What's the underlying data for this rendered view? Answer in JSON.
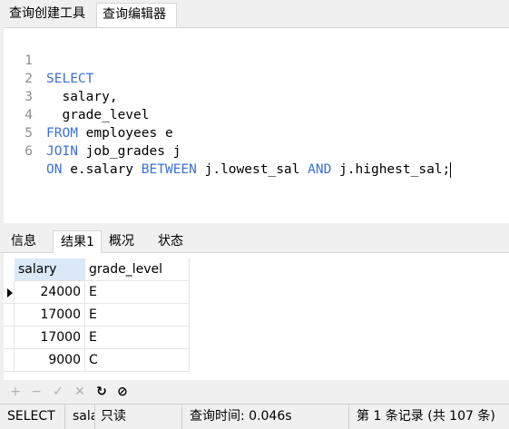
{
  "top_tabs": [
    "查询创建工具",
    "查询编辑器"
  ],
  "editor": {
    "lines": [
      {
        "num": "1",
        "kw1": "SELECT",
        "rest": "",
        "kw2": "",
        "rest2": ""
      },
      {
        "num": "2",
        "kw1": "",
        "rest": "  salary,",
        "kw2": "",
        "rest2": ""
      },
      {
        "num": "3",
        "kw1": "",
        "rest": "  grade_level",
        "kw2": "",
        "rest2": ""
      },
      {
        "num": "4",
        "kw1": "FROM",
        "rest": " employees e",
        "kw2": "",
        "rest2": ""
      },
      {
        "num": "5",
        "kw1": "JOIN",
        "rest": " job_grades j",
        "kw2": "",
        "rest2": ""
      },
      {
        "num": "6",
        "kw1": "ON",
        "rest": " e.salary ",
        "kw2": "BETWEEN",
        "rest2": " j.lowest_sal ",
        "kw3": "AND",
        "rest3": " j.highest_sal;"
      }
    ]
  },
  "bottom_tabs": [
    "信息",
    "结果1",
    "概况",
    "状态"
  ],
  "results": {
    "columns": [
      "salary",
      "grade_level"
    ],
    "rows": [
      [
        "24000",
        "E"
      ],
      [
        "17000",
        "E"
      ],
      [
        "17000",
        "E"
      ],
      [
        "9000",
        "C"
      ]
    ]
  },
  "toolbar": {
    "add": "+",
    "remove": "−",
    "apply": "✓",
    "discard": "✕",
    "refresh": "↻",
    "stop": "⊘"
  },
  "status": {
    "sql": "SELECT",
    "truncated": "sala",
    "readonly": "只读",
    "query_time": "查询时间: 0.046s",
    "record": "第 1 条记录 (共 107 条)"
  }
}
